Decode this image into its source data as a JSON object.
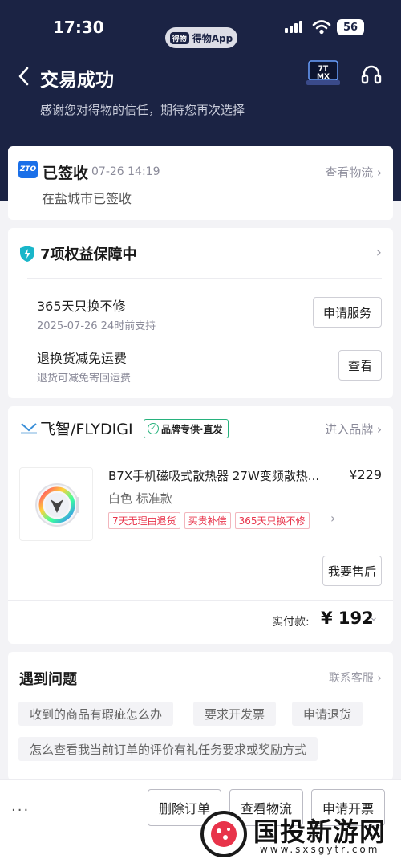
{
  "status_bar": {
    "time": "17:30",
    "pill_logo": "得物",
    "pill_text": "得物App",
    "battery": "56"
  },
  "header": {
    "back_icon": "chevron-left-icon",
    "title": "交易成功",
    "subtitle": "感谢您对得物的信任，期待您再次选择",
    "badge_icon": "device-badge-icon",
    "badge_text": "7T MX",
    "service_icon": "headset-icon"
  },
  "logistics": {
    "carrier_logo": "ZTO",
    "status": "已签收",
    "time": "07-26 14:19",
    "view_link": "查看物流",
    "location": "在盐城市已签收"
  },
  "rights": {
    "title": "7项权益保障中",
    "icon": "shield-bolt-icon",
    "items": [
      {
        "name": "365天只换不修",
        "sub": "2025-07-26 24时前支持",
        "button": "申请服务"
      },
      {
        "name": "退换货减免运费",
        "sub": "退货可减免寄回运费",
        "button": "查看"
      }
    ]
  },
  "order": {
    "brand_name": "飞智/FLYDIGI",
    "brand_tag": "品牌专供·直发",
    "enter_brand": "进入品牌",
    "product_title": "B7X手机磁吸式散热器 27W变频散热...",
    "price": "¥229",
    "spec": "白色 标准款",
    "tags": [
      "7天无理由退货",
      "买贵补偿",
      "365天只换不修"
    ],
    "after_sale_button": "我要售后",
    "paid_label": "实付款:",
    "paid_amount": "¥ 192"
  },
  "help": {
    "title": "遇到问题",
    "contact": "联系客服",
    "chips": [
      "收到的商品有瑕疵怎么办",
      "要求开发票",
      "申请退货",
      "怎么查看我当前订单的评价有礼任务要求或奖励方式"
    ]
  },
  "bottom_bar": {
    "more": "···",
    "buttons": [
      "删除订单",
      "查看物流",
      "申请开票"
    ]
  },
  "watermark": {
    "text": "国投新游网",
    "url": "www.sxsgytr.com"
  },
  "colors": {
    "header_bg": "#1b2344",
    "accent_red": "#e8334a",
    "brand_green": "#27b27d"
  }
}
